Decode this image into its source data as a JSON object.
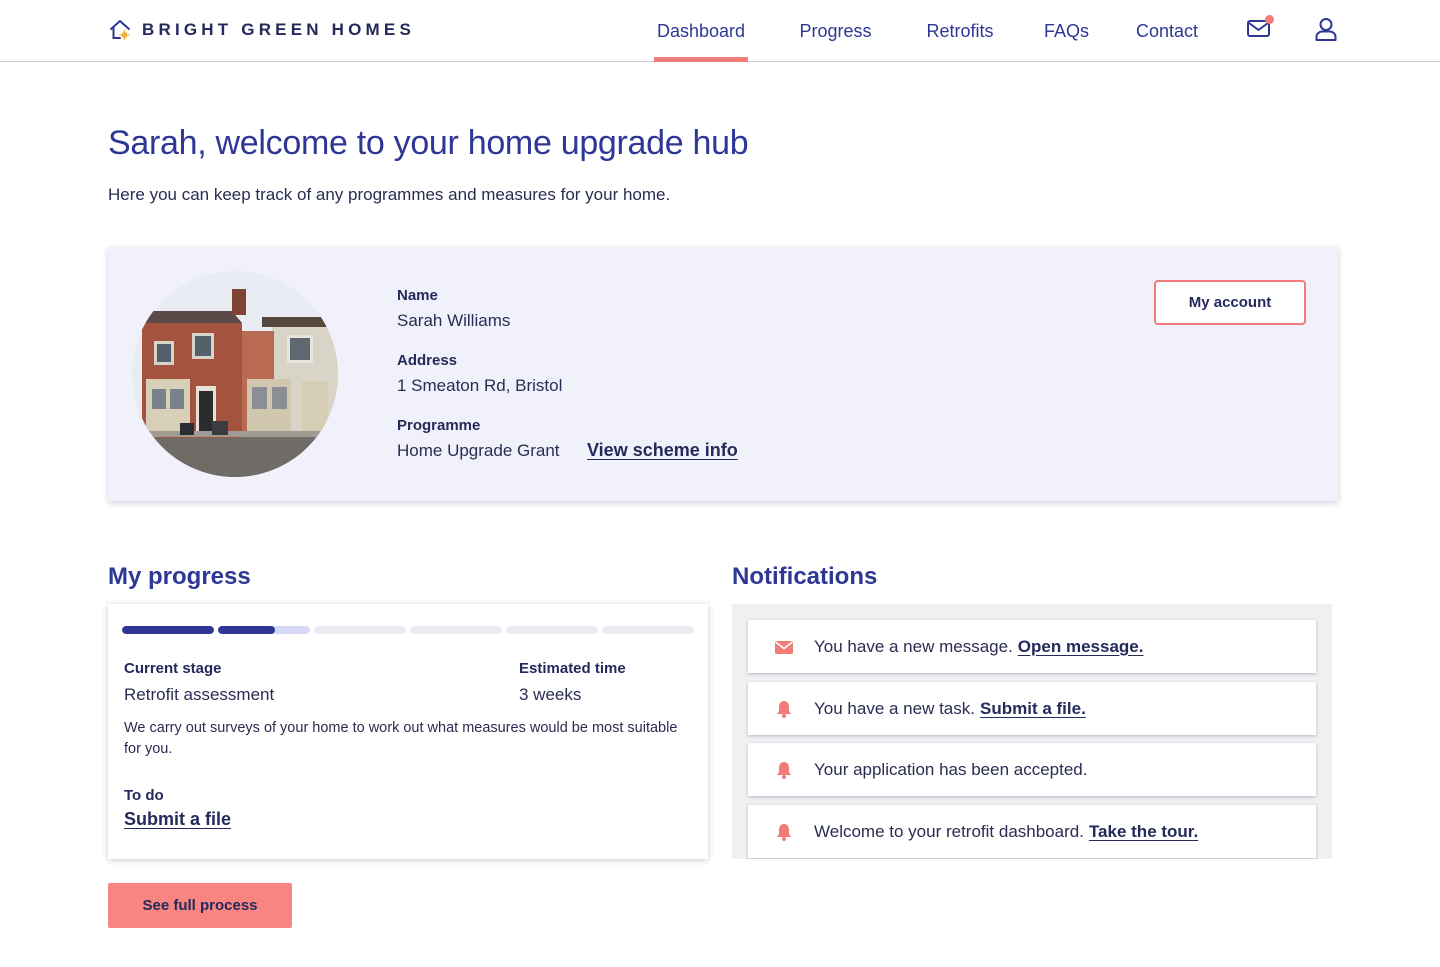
{
  "brand": {
    "name": "BRIGHT GREEN HOMES",
    "icon": "house-icon"
  },
  "nav": {
    "items": [
      {
        "label": "Dashboard",
        "active": true
      },
      {
        "label": "Progress",
        "active": false
      },
      {
        "label": "Retrofits",
        "active": false
      },
      {
        "label": "FAQs",
        "active": false
      },
      {
        "label": "Contact",
        "active": false
      }
    ],
    "mail_icon": "mail-icon",
    "mail_has_unread": true,
    "account_icon": "user-icon"
  },
  "intro": {
    "title": "Sarah, welcome to your home upgrade hub",
    "subtitle": "Here you can keep track of any programmes and measures for your home."
  },
  "profile": {
    "name_label": "Name",
    "name_value": "Sarah Williams",
    "address_label": "Address",
    "address_value": "1 Smeaton Rd, Bristol",
    "programme_label": "Programme",
    "programme_value": "Home Upgrade Grant",
    "scheme_link": "View scheme info",
    "account_button": "My account"
  },
  "progress": {
    "title": "My progress",
    "steps_total": 6,
    "steps_completed": 1,
    "current_step_fraction": 0.62,
    "current_stage_label": "Current stage",
    "current_stage_value": "Retrofit assessment",
    "estimated_time_label": "Estimated time",
    "estimated_time_value": "3 weeks",
    "description": "We carry out surveys of your home to work out what measures would be most suitable for you.",
    "todo_label": "To do",
    "todo_link": "Submit a file",
    "full_process_button": "See full process"
  },
  "notifications": {
    "title": "Notifications",
    "items": [
      {
        "icon": "envelope-icon",
        "text": "You have a new message.",
        "link": "Open message."
      },
      {
        "icon": "bell-icon",
        "text": "You have a new task.",
        "link": "Submit a file."
      },
      {
        "icon": "bell-icon",
        "text": "Your application has been accepted.",
        "link": ""
      },
      {
        "icon": "bell-icon",
        "text": "Welcome to your retrofit dashboard.",
        "link": "Take the tour."
      }
    ]
  },
  "colors": {
    "primary": "#2e3796",
    "accent": "#f27c78",
    "card_background": "#f0f1fb"
  }
}
